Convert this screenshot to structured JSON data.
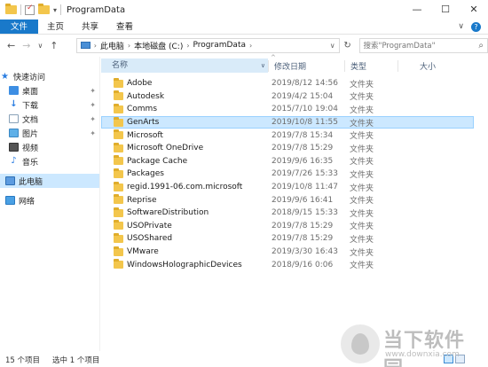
{
  "window": {
    "title": "ProgramData",
    "controls": {
      "minimize": "—",
      "maximize": "☐",
      "close": "✕"
    }
  },
  "ribbon": {
    "tabs": [
      "文件",
      "主页",
      "共享",
      "查看"
    ],
    "expand_icon": "∨",
    "help_icon": "?"
  },
  "address": {
    "back": "←",
    "forward": "→",
    "recent": "∨",
    "up": "↑",
    "crumbs": [
      "此电脑",
      "本地磁盘 (C:)",
      "ProgramData"
    ],
    "separator": "›",
    "dropdown": "∨",
    "refresh": "↻"
  },
  "search": {
    "placeholder": "搜索\"ProgramData\"",
    "icon": "search-icon"
  },
  "nav": {
    "quick_access": "快速访问",
    "items": [
      {
        "label": "桌面",
        "pinned": true,
        "icon": "desktop-icon"
      },
      {
        "label": "下载",
        "pinned": true,
        "icon": "download-icon"
      },
      {
        "label": "文档",
        "pinned": true,
        "icon": "documents-icon"
      },
      {
        "label": "图片",
        "pinned": true,
        "icon": "pictures-icon"
      },
      {
        "label": "视频",
        "pinned": false,
        "icon": "videos-icon"
      },
      {
        "label": "音乐",
        "pinned": false,
        "icon": "music-icon"
      }
    ],
    "this_pc": "此电脑",
    "network": "网络",
    "pin_glyph": "✦"
  },
  "columns": {
    "name": "名称",
    "date": "修改日期",
    "type": "类型",
    "size": "大小"
  },
  "files": [
    {
      "name": "Adobe",
      "date": "2019/8/12 14:56",
      "type": "文件夹",
      "selected": false
    },
    {
      "name": "Autodesk",
      "date": "2019/4/2 15:04",
      "type": "文件夹",
      "selected": false
    },
    {
      "name": "Comms",
      "date": "2015/7/10 19:04",
      "type": "文件夹",
      "selected": false
    },
    {
      "name": "GenArts",
      "date": "2019/10/8 11:55",
      "type": "文件夹",
      "selected": true
    },
    {
      "name": "Microsoft",
      "date": "2019/7/8 15:34",
      "type": "文件夹",
      "selected": false
    },
    {
      "name": "Microsoft OneDrive",
      "date": "2019/7/8 15:29",
      "type": "文件夹",
      "selected": false
    },
    {
      "name": "Package Cache",
      "date": "2019/9/6 16:35",
      "type": "文件夹",
      "selected": false
    },
    {
      "name": "Packages",
      "date": "2019/7/26 15:33",
      "type": "文件夹",
      "selected": false
    },
    {
      "name": "regid.1991-06.com.microsoft",
      "date": "2019/10/8 11:47",
      "type": "文件夹",
      "selected": false
    },
    {
      "name": "Reprise",
      "date": "2019/9/6 16:41",
      "type": "文件夹",
      "selected": false
    },
    {
      "name": "SoftwareDistribution",
      "date": "2018/9/15 15:33",
      "type": "文件夹",
      "selected": false
    },
    {
      "name": "USOPrivate",
      "date": "2019/7/8 15:29",
      "type": "文件夹",
      "selected": false
    },
    {
      "name": "USOShared",
      "date": "2019/7/8 15:29",
      "type": "文件夹",
      "selected": false
    },
    {
      "name": "VMware",
      "date": "2019/3/30 16:43",
      "type": "文件夹",
      "selected": false
    },
    {
      "name": "WindowsHolographicDevices",
      "date": "2018/9/16 0:06",
      "type": "文件夹",
      "selected": false
    }
  ],
  "status": {
    "count": "15 个项目",
    "selection": "选中 1 个项目"
  },
  "watermark": {
    "title": "当下软件园",
    "url": "www.downxia.com"
  },
  "colors": {
    "accent": "#1979ca",
    "selection": "#cce8ff",
    "folder": "#f3c64c"
  }
}
